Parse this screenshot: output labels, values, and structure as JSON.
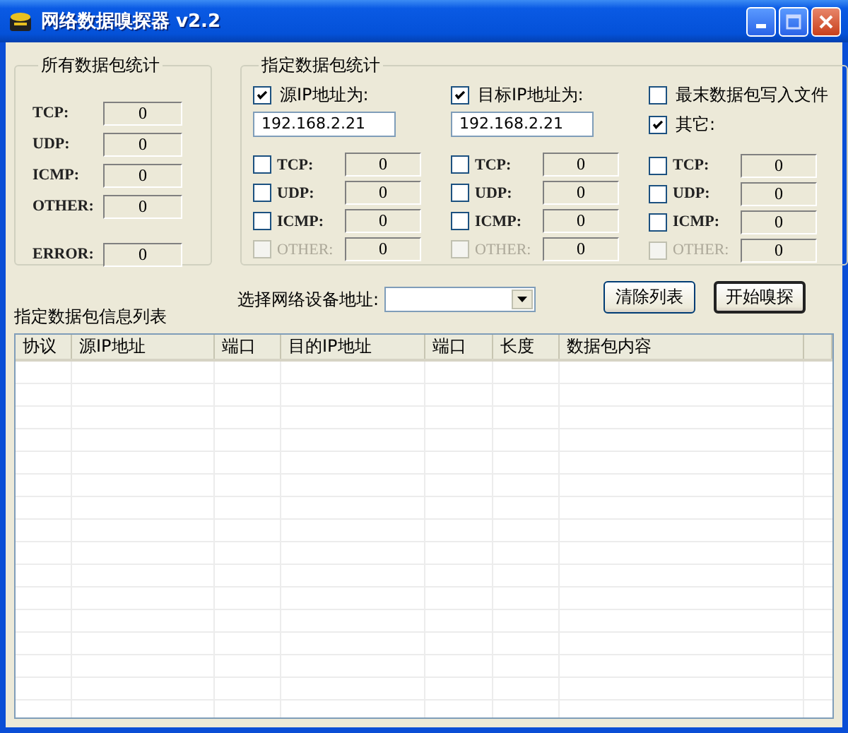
{
  "window": {
    "title": "网络数据嗅探器 v2.2"
  },
  "all_stats": {
    "title": "所有数据包统计",
    "rows": [
      {
        "kind": "counter",
        "label": "TCP:",
        "value": "0"
      },
      {
        "kind": "counter",
        "label": "UDP:",
        "value": "0"
      },
      {
        "kind": "counter",
        "label": "ICMP:",
        "value": "0"
      },
      {
        "kind": "counter",
        "label": "OTHER:",
        "value": "0"
      },
      {
        "kind": "error",
        "label": "ERROR:",
        "value": "0"
      }
    ]
  },
  "filter_stats": {
    "title": "指定数据包统计",
    "columns": [
      {
        "kind": "address",
        "label": "源IP地址为:",
        "checked": true,
        "address": "192.168.2.21",
        "protocols": [
          {
            "label": "TCP:",
            "checked": false,
            "disabled": false,
            "value": "0"
          },
          {
            "label": "UDP:",
            "checked": false,
            "disabled": false,
            "value": "0"
          },
          {
            "label": "ICMP:",
            "checked": false,
            "disabled": false,
            "value": "0"
          },
          {
            "label": "OTHER:",
            "checked": false,
            "disabled": true,
            "value": "0"
          }
        ]
      },
      {
        "kind": "address",
        "label": "目标IP地址为:",
        "checked": true,
        "address": "192.168.2.21",
        "protocols": [
          {
            "label": "TCP:",
            "checked": false,
            "disabled": false,
            "value": "0"
          },
          {
            "label": "UDP:",
            "checked": false,
            "disabled": false,
            "value": "0"
          },
          {
            "label": "ICMP:",
            "checked": false,
            "disabled": false,
            "value": "0"
          },
          {
            "label": "OTHER:",
            "checked": false,
            "disabled": true,
            "value": "0"
          }
        ]
      },
      {
        "kind": "other",
        "option": {
          "label": "最末数据包写入文件",
          "checked": false
        },
        "label": "其它:",
        "checked": true,
        "protocols": [
          {
            "label": "TCP:",
            "checked": false,
            "disabled": false,
            "value": "0"
          },
          {
            "label": "UDP:",
            "checked": false,
            "disabled": false,
            "value": "0"
          },
          {
            "label": "ICMP:",
            "checked": false,
            "disabled": false,
            "value": "0"
          },
          {
            "label": "OTHER:",
            "checked": false,
            "disabled": true,
            "value": "0"
          }
        ]
      }
    ]
  },
  "device": {
    "label": "选择网络设备地址:"
  },
  "buttons": [
    {
      "label": "清除列表",
      "default": false
    },
    {
      "label": "开始嗅探",
      "default": true
    }
  ],
  "packet_list": {
    "title": "指定数据包信息列表",
    "columns": [
      "协议",
      "源IP地址",
      "端口",
      "目的IP地址",
      "端口",
      "长度",
      "数据包内容"
    ]
  }
}
